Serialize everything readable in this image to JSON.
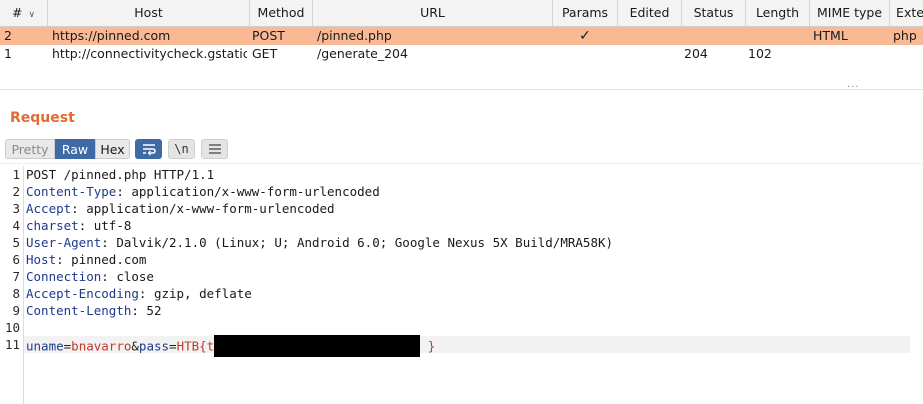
{
  "table": {
    "columns": [
      "#",
      "Host",
      "Method",
      "URL",
      "Params",
      "Edited",
      "Status",
      "Length",
      "MIME type",
      "Exte"
    ],
    "rows": [
      {
        "num": "2",
        "host": "https://pinned.com",
        "method": "POST",
        "url": "/pinned.php",
        "params": "✓",
        "edited": "",
        "status": "",
        "length": "",
        "mime": "HTML",
        "ext": "php",
        "selected": true
      },
      {
        "num": "1",
        "host": "http://connectivitycheck.gstatic....",
        "method": "GET",
        "url": "/generate_204",
        "params": "",
        "edited": "",
        "status": "204",
        "length": "102",
        "mime": "",
        "ext": "",
        "selected": false
      }
    ],
    "selected_color": "#f9b995"
  },
  "request": {
    "title": "Request",
    "title_color": "#e36b33",
    "toolbar": {
      "tabs": [
        "Pretty",
        "Raw",
        "Hex"
      ],
      "active_tab": "Raw",
      "newline_label": "\\n",
      "icons": [
        "wrap-lines-icon",
        "show-newlines-icon",
        "menu-icon"
      ]
    },
    "lines": [
      {
        "num": "1",
        "text": "POST /pinned.php HTTP/1.1"
      },
      {
        "num": "2",
        "name": "Content-Type",
        "value": " application/x-www-form-urlencoded"
      },
      {
        "num": "3",
        "name": "Accept",
        "value": " application/x-www-form-urlencoded"
      },
      {
        "num": "4",
        "name": "charset",
        "value": " utf-8"
      },
      {
        "num": "5",
        "name": "User-Agent",
        "value": " Dalvik/2.1.0 (Linux; U; Android 6.0; Google Nexus 5X Build/MRA58K)"
      },
      {
        "num": "6",
        "name": "Host",
        "value": " pinned.com"
      },
      {
        "num": "7",
        "name": "Connection",
        "value": " close"
      },
      {
        "num": "8",
        "name": "Accept-Encoding",
        "value": " gzip, deflate"
      },
      {
        "num": "9",
        "name": "Content-Length",
        "value": " 52"
      },
      {
        "num": "10",
        "text": ""
      },
      {
        "num": "11"
      }
    ],
    "body": {
      "uname_key": "uname",
      "eq1": "=",
      "uname_value": "bnavarro",
      "amp": "&",
      "pass_key": "pass",
      "eq2": "=",
      "pass_prefix": "HTB{t",
      "pass_suffix": " }"
    },
    "colors": {
      "header_name": "#1d3a8c",
      "param_value": "#c0392b",
      "active_tab": "#3f6aa6"
    }
  }
}
